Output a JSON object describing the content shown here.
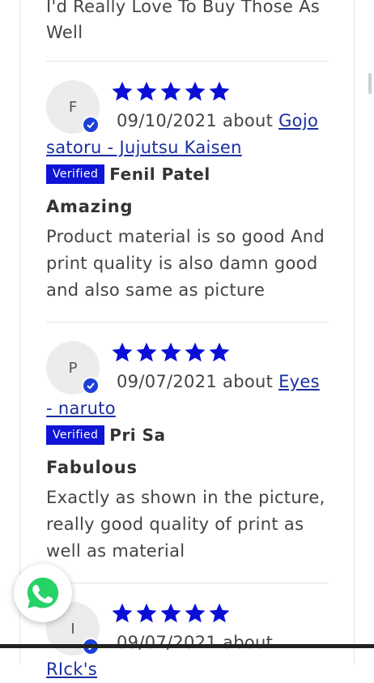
{
  "previous_review": {
    "text": "I'd Really Love To Buy Those As Well"
  },
  "reviews": [
    {
      "initial": "F",
      "date": "09/10/2021",
      "about_label": "about",
      "product": "Gojo satoru - Jujutsu Kaisen",
      "verified_label": "Verified",
      "author": "Fenil Patel",
      "title": "Amazing",
      "body": "Product material is so good And print quality is also damn good and also same as picture",
      "rating": 5
    },
    {
      "initial": "P",
      "date": "09/07/2021",
      "about_label": "about",
      "product": "Eyes - naruto",
      "verified_label": "Verified",
      "author": "Pri Sa",
      "title": "Fabulous",
      "body": "Exactly as shown in the picture, really good quality of print as well as material",
      "rating": 5
    },
    {
      "initial": "I",
      "date": "09/07/2021",
      "about_label": "about",
      "product": "RIck's",
      "rating": 5
    }
  ],
  "icons": {
    "star": "star-icon",
    "check": "check-icon",
    "whatsapp": "whatsapp-icon"
  },
  "colors": {
    "star": "#0b0fd6",
    "verified_bg": "#0f14d6",
    "link": "#1a2fa0",
    "badge": "#1d3fd8",
    "whatsapp": "#25d366"
  }
}
